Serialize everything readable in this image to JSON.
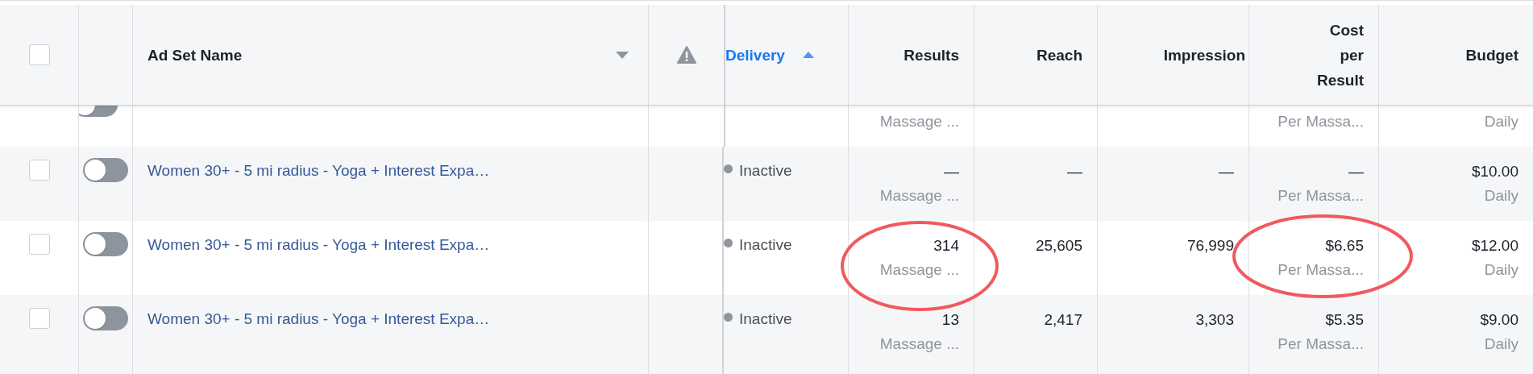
{
  "columns": [
    {
      "kind": "checkbox",
      "checked": false
    },
    {
      "kind": "blank"
    },
    {
      "kind": "label",
      "label": "Ad Set Name",
      "sorted": false,
      "dropdown": true
    },
    {
      "kind": "warning"
    },
    {
      "kind": "label",
      "label": "Delivery",
      "sorted": true,
      "dropdown": false
    },
    {
      "kind": "label",
      "label": "Results",
      "sorted": false,
      "dropdown": false
    },
    {
      "kind": "label",
      "label": "Reach",
      "sorted": false,
      "dropdown": false
    },
    {
      "kind": "label",
      "label": "Impression",
      "sorted": false,
      "dropdown": false
    },
    {
      "kind": "label",
      "label": "Cost per Result",
      "sorted": false,
      "dropdown": false
    },
    {
      "kind": "label",
      "label": "Budget",
      "sorted": false,
      "dropdown": false
    }
  ],
  "clipped_row": {
    "on": false,
    "results_sub": "Massage ...",
    "cost_sub": "Per Massa...",
    "budget_sub": "Daily"
  },
  "rows": [
    {
      "checked": false,
      "on": false,
      "name": "Women 30+ - 5 mi radius - Yoga + Interest Expa…",
      "status": "Inactive",
      "results": "—",
      "results_sub": "Massage ...",
      "reach": "—",
      "impressions": "—",
      "cost": "—",
      "cost_sub": "Per Massa...",
      "budget": "$10.00",
      "budget_sub": "Daily",
      "circled": false
    },
    {
      "checked": false,
      "on": false,
      "name": "Women 30+ - 5 mi radius - Yoga + Interest Expa…",
      "status": "Inactive",
      "results": "314",
      "results_sub": "Massage ...",
      "reach": "25,605",
      "impressions": "76,999",
      "cost": "$6.65",
      "cost_sub": "Per Massa...",
      "budget": "$12.00",
      "budget_sub": "Daily",
      "circled": true
    },
    {
      "checked": false,
      "on": false,
      "name": "Women 30+ - 5 mi radius - Yoga + Interest Expa…",
      "status": "Inactive",
      "results": "13",
      "results_sub": "Massage ...",
      "reach": "2,417",
      "impressions": "3,303",
      "cost": "$5.35",
      "cost_sub": "Per Massa...",
      "budget": "$9.00",
      "budget_sub": "Daily",
      "circled": false
    }
  ]
}
